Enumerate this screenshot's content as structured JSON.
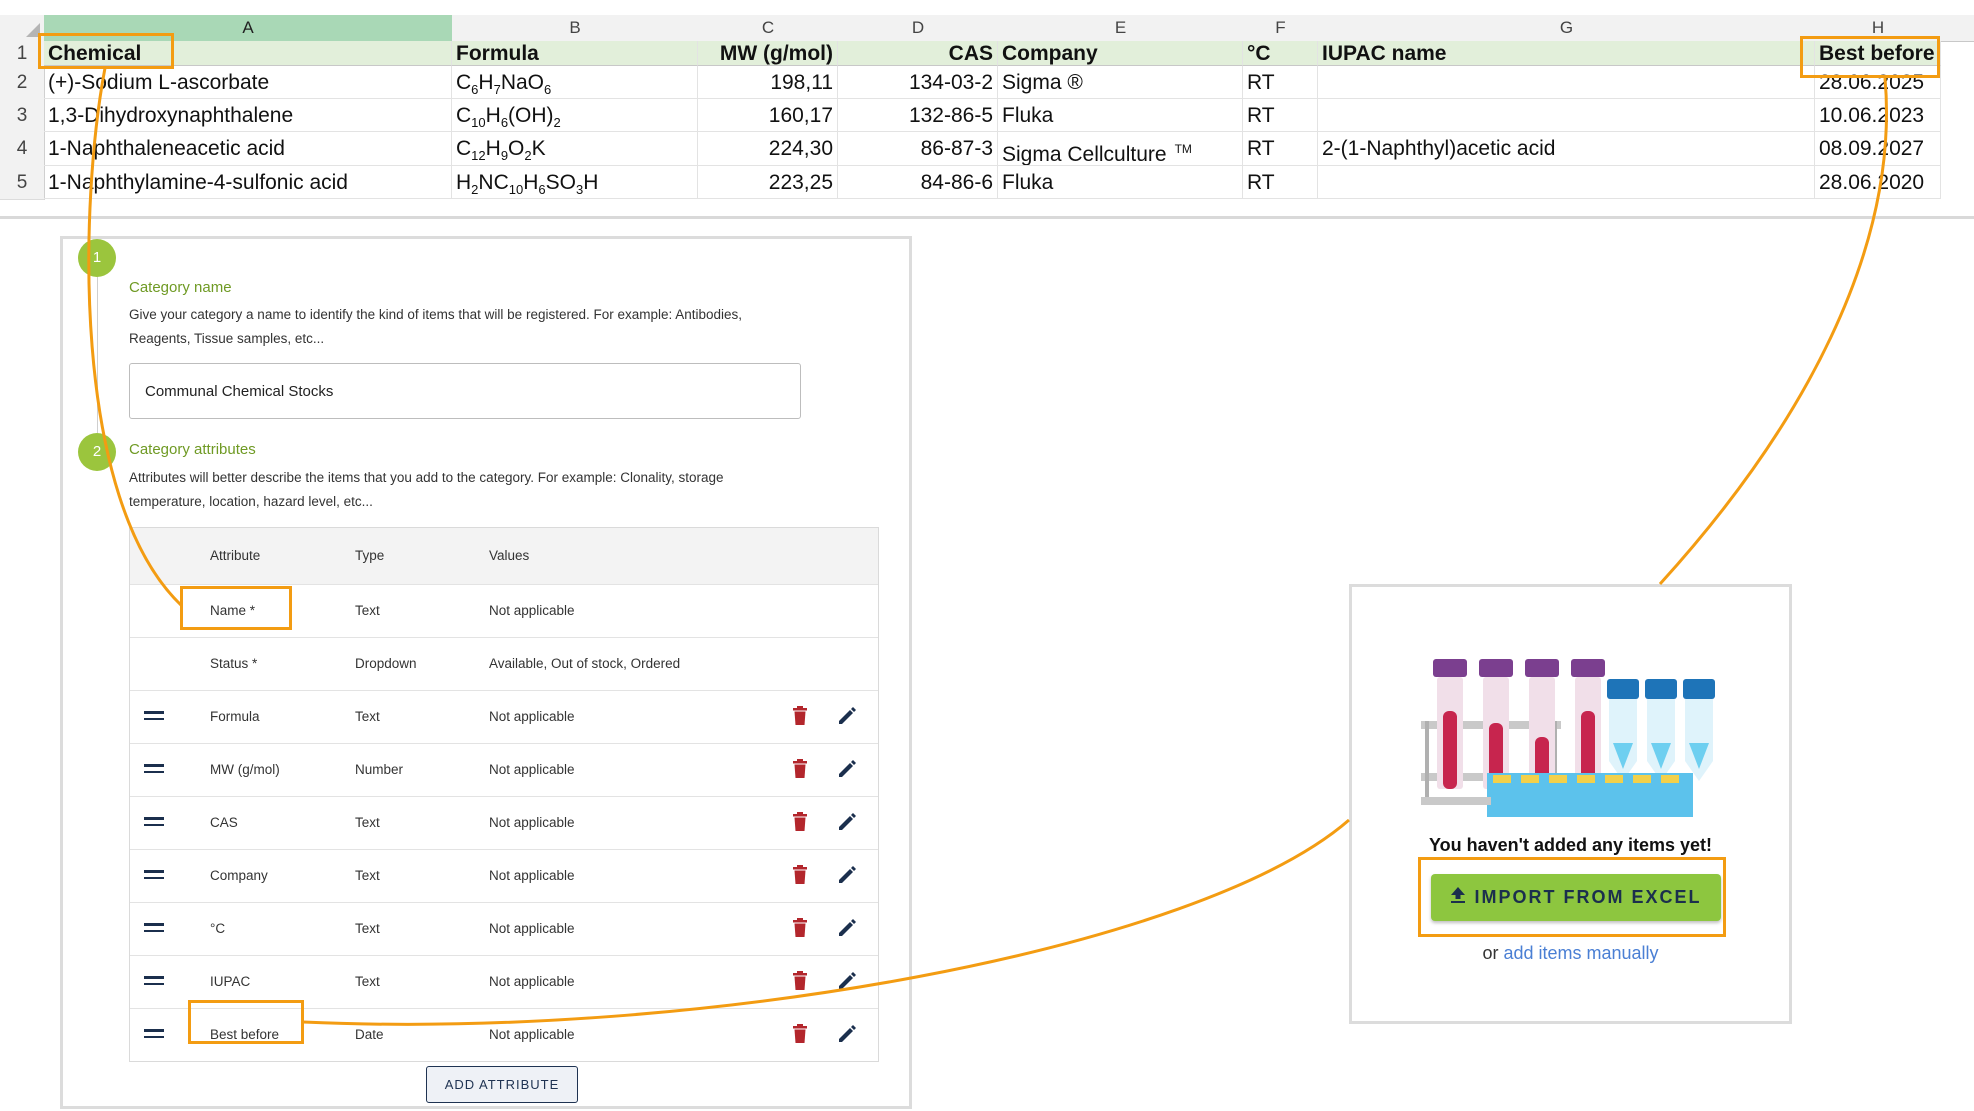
{
  "sheet": {
    "columns": [
      "A",
      "B",
      "C",
      "D",
      "E",
      "F",
      "G",
      "H"
    ],
    "selected_column": "A",
    "row_numbers": [
      "1",
      "2",
      "3",
      "4",
      "5"
    ],
    "header": {
      "a": "Chemical",
      "b": "Formula",
      "c": "MW (g/mol)",
      "d": "CAS",
      "e": "Company",
      "f": "°C",
      "g": "IUPAC name",
      "h": "Best before"
    },
    "rows": [
      {
        "chemical": "(+)-Sodium L-ascorbate",
        "formula": [
          [
            "C",
            ""
          ],
          [
            "6",
            "sub"
          ],
          [
            "H",
            ""
          ],
          [
            "7",
            "sub"
          ],
          [
            "NaO",
            ""
          ],
          [
            "6",
            "sub"
          ]
        ],
        "mw": "198,11",
        "cas": "134-03-2",
        "company": "Sigma ®",
        "temp": "RT",
        "iupac": "",
        "best": "28.06.2025"
      },
      {
        "chemical": "1,3-Dihydroxynaphthalene",
        "formula": [
          [
            "C",
            ""
          ],
          [
            "10",
            "sub"
          ],
          [
            "H",
            ""
          ],
          [
            "6",
            "sub"
          ],
          [
            "(OH)",
            ""
          ],
          [
            "2",
            "sub"
          ]
        ],
        "mw": "160,17",
        "cas": "132-86-5",
        "company": "Fluka",
        "temp": "RT",
        "iupac": "",
        "best": "10.06.2023"
      },
      {
        "chemical": "1-Naphthaleneacetic acid",
        "formula": [
          [
            "C",
            ""
          ],
          [
            "12",
            "sub"
          ],
          [
            "H",
            ""
          ],
          [
            "9",
            "sub"
          ],
          [
            "O",
            ""
          ],
          [
            "2",
            "sub"
          ],
          [
            "K",
            ""
          ]
        ],
        "mw": "224,30",
        "cas": "86-87-3",
        "company": "Sigma Cellculture",
        "company_tm": "TM",
        "temp": "RT",
        "iupac": "2-(1-Naphthyl)acetic acid",
        "best": "08.09.2027"
      },
      {
        "chemical": "1-Naphthylamine-4-sulfonic acid",
        "formula": [
          [
            "H",
            ""
          ],
          [
            "2",
            "sub"
          ],
          [
            "NC",
            ""
          ],
          [
            "10",
            "sub"
          ],
          [
            "H",
            ""
          ],
          [
            "6",
            "sub"
          ],
          [
            "SO",
            ""
          ],
          [
            "3",
            "sub"
          ],
          [
            "H",
            ""
          ]
        ],
        "mw": "223,25",
        "cas": "84-86-6",
        "company": "Fluka",
        "temp": "RT",
        "iupac": "",
        "best": "28.06.2020"
      }
    ]
  },
  "category": {
    "step1": {
      "number": "1",
      "title": "Category name",
      "desc_line1": "Give your category a name to identify the kind of items that will be registered. For example: Antibodies,",
      "desc_line2": "Reagents, Tissue samples, etc...",
      "input_value": "Communal Chemical Stocks"
    },
    "step2": {
      "number": "2",
      "title": "Category attributes",
      "desc_line1": "Attributes will better describe the items that you add to the category. For example: Clonality, storage",
      "desc_line2": "temperature, location, hazard level, etc..."
    },
    "table": {
      "headers": {
        "attribute": "Attribute",
        "type": "Type",
        "values": "Values"
      },
      "rows": [
        {
          "attribute": "Name *",
          "type": "Text",
          "values": "Not applicable",
          "editable": false
        },
        {
          "attribute": "Status *",
          "type": "Dropdown",
          "values": "Available, Out of stock, Ordered",
          "editable": false
        },
        {
          "attribute": "Formula",
          "type": "Text",
          "values": "Not applicable",
          "editable": true
        },
        {
          "attribute": "MW (g/mol)",
          "type": "Number",
          "values": "Not applicable",
          "editable": true
        },
        {
          "attribute": "CAS",
          "type": "Text",
          "values": "Not applicable",
          "editable": true
        },
        {
          "attribute": "Company",
          "type": "Text",
          "values": "Not applicable",
          "editable": true
        },
        {
          "attribute": "°C",
          "type": "Text",
          "values": "Not applicable",
          "editable": true
        },
        {
          "attribute": "IUPAC",
          "type": "Text",
          "values": "Not applicable",
          "editable": true
        },
        {
          "attribute": "Best before",
          "type": "Date",
          "values": "Not applicable",
          "editable": true
        }
      ]
    },
    "add_attribute_label": "ADD ATTRIBUTE"
  },
  "empty_state": {
    "message": "You haven't added any items yet!",
    "import_label": "IMPORT FROM EXCEL",
    "or_text": "or",
    "manual_link": "add items manually"
  },
  "colors": {
    "highlight": "#f39c12",
    "step_green": "#9bc53d",
    "import_green": "#8dc63f",
    "navy": "#1b2f4d",
    "delete_red": "#b3262c",
    "link_blue": "#4a7fd4",
    "sheet_header_fill": "#e2efda"
  },
  "icons": {
    "drag": "drag-handle-icon",
    "delete": "trash-icon",
    "edit": "pencil-icon",
    "upload": "upload-arrow-icon",
    "illustration": "test-tubes-illustration"
  }
}
